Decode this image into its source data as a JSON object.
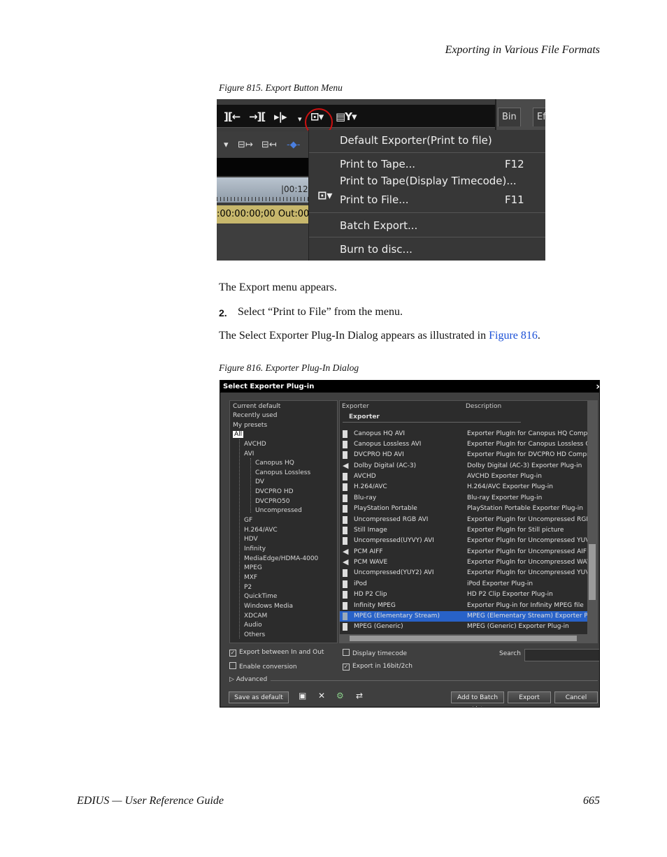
{
  "header": {
    "running_title": "Exporting in Various File Formats"
  },
  "figure815": {
    "caption": "Figure 815.  Export Button Menu",
    "toolbar_icons": [
      "][←",
      "→][",
      "▸|▸",
      "▾",
      "⊡▾",
      "▤Y▾"
    ],
    "bin_tabs": [
      "Bin",
      "Ef"
    ],
    "timecode_ruler": "|00:12",
    "timecode_bar": ":00:00:00;00 Out:00",
    "menu_items": [
      {
        "label": "Default Exporter(Print to file)",
        "shortcut": ""
      },
      {
        "label": "Print to Tape...",
        "shortcut": "F12"
      },
      {
        "label": "Print to Tape(Display Timecode)...",
        "shortcut": ""
      },
      {
        "label": "Print to File...",
        "shortcut": "F11"
      },
      {
        "label": "Batch Export...",
        "shortcut": ""
      },
      {
        "label": "Burn to disc...",
        "shortcut": ""
      }
    ]
  },
  "body": {
    "para1": "The Export menu appears.",
    "step_number": "2.",
    "step_text": "Select “Print to File” from the menu.",
    "para2_text": "The Select Exporter Plug-In Dialog appears as illustrated in ",
    "para2_link": "Figure 816",
    "para2_end": "."
  },
  "figure816": {
    "caption": "Figure 816.  Exporter Plug-In Dialog",
    "dialog_title": "Select Exporter Plug-in",
    "close": "×",
    "tree_items": [
      "Current default",
      "Recently used",
      "My presets",
      "All",
      "AVCHD",
      "AVI",
      "Canopus HQ",
      "Canopus Lossless",
      "DV",
      "DVCPRO HD",
      "DVCPRO50",
      "Uncompressed",
      "GF",
      "H.264/AVC",
      "HDV",
      "Infinity",
      "MediaEdge/HDMA-4000",
      "MPEG",
      "MXF",
      "P2",
      "QuickTime",
      "Windows Media",
      "XDCAM",
      "Audio",
      "Others"
    ],
    "list_header_exporter": "Exporter",
    "list_header_description": "Description",
    "group_label": "Exporter",
    "exporters": [
      {
        "name": "Canopus HQ AVI",
        "desc": "Exporter PlugIn for Canopus HQ Compress"
      },
      {
        "name": "Canopus Lossless AVI",
        "desc": "Exporter PlugIn for Canopus Lossless Com"
      },
      {
        "name": "DVCPRO HD AVI",
        "desc": "Exporter PlugIn for DVCPRO HD Compress"
      },
      {
        "name": "Dolby Digital (AC-3)",
        "desc": "Dolby Digital (AC-3) Exporter Plug-in"
      },
      {
        "name": "AVCHD",
        "desc": "AVCHD Exporter Plug-in"
      },
      {
        "name": "H.264/AVC",
        "desc": "H.264/AVC Exporter Plug-in"
      },
      {
        "name": "Blu-ray",
        "desc": "Blu-ray Exporter Plug-in"
      },
      {
        "name": "PlayStation Portable",
        "desc": "PlayStation Portable Exporter Plug-in"
      },
      {
        "name": "Uncompressed RGB AVI",
        "desc": "Exporter PlugIn for Uncompressed RGB Av"
      },
      {
        "name": "Still Image",
        "desc": "Exporter PlugIn for Still picture"
      },
      {
        "name": "Uncompressed(UYVY) AVI",
        "desc": "Exporter PlugIn for Uncompressed YUV AV"
      },
      {
        "name": "PCM AIFF",
        "desc": "Exporter PlugIn for Uncompressed AIFF fil"
      },
      {
        "name": "PCM WAVE",
        "desc": "Exporter PlugIn for Uncompressed WAVE f"
      },
      {
        "name": "Uncompressed(YUY2) AVI",
        "desc": "Exporter PlugIn for Uncompressed YUV AV"
      },
      {
        "name": "iPod",
        "desc": "iPod Exporter Plug-in"
      },
      {
        "name": "HD P2 Clip",
        "desc": "HD P2 Clip Exporter Plug-in"
      },
      {
        "name": "Infinity MPEG",
        "desc": "Exporter Plug-in for Infinity MPEG file"
      },
      {
        "name": "MPEG (Elementary Stream)",
        "desc": "MPEG (Elementary Stream) Exporter Plug-i"
      },
      {
        "name": "MPEG (Generic)",
        "desc": "MPEG (Generic) Exporter Plug-in"
      }
    ],
    "options": {
      "export_in_out": "Export between In and Out",
      "enable_conversion": "Enable conversion",
      "advanced": "Advanced",
      "display_timecode": "Display timecode",
      "export_16bit": "Export in 16bit/2ch",
      "search_label": "Search"
    },
    "buttons": {
      "save_default": "Save as default",
      "add_batch": "Add to Batch List",
      "export": "Export",
      "cancel": "Cancel"
    }
  },
  "footer": {
    "left": "EDIUS  —  User Reference Guide",
    "page": "665"
  }
}
